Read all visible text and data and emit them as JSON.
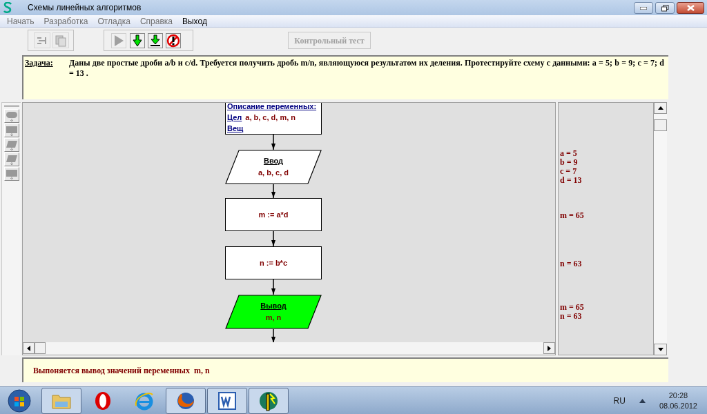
{
  "window": {
    "title": "Схемы линейных алгоритмов"
  },
  "menu": [
    {
      "label": "Начать",
      "disabled": true
    },
    {
      "label": "Разработка",
      "disabled": true
    },
    {
      "label": "Отладка",
      "disabled": true
    },
    {
      "label": "Справка",
      "disabled": true
    },
    {
      "label": "Выход",
      "disabled": false
    }
  ],
  "toolbar": {
    "edit_tools": [
      {
        "kind": "align",
        "disabled": true
      },
      {
        "kind": "copy",
        "disabled": true
      }
    ],
    "run_tools": [
      {
        "kind": "run",
        "disabled": true
      },
      {
        "kind": "step",
        "disabled": false
      },
      {
        "kind": "step_into",
        "disabled": false
      },
      {
        "kind": "stop",
        "disabled": false
      }
    ],
    "test_button": {
      "label": "Контрольный тест",
      "disabled": true
    }
  },
  "task": {
    "label": "Задача:",
    "text": "Даны две простые дроби a/b и c/d. Требуется получить дробь m/n, являющуюся результатом их деления. Протестируйте схему с данными: a = 5;  b = 9;  c = 7;  d = 13 ."
  },
  "palette": [
    {
      "kind": "terminator"
    },
    {
      "kind": "process"
    },
    {
      "kind": "input"
    },
    {
      "kind": "output"
    },
    {
      "kind": "process"
    }
  ],
  "flowchart": {
    "declaration": {
      "title": "Описание переменных:",
      "lines": [
        {
          "type": "Цел",
          "vars": "a, b, c, d, m, n"
        },
        {
          "type": "Вещ"
        }
      ]
    },
    "blocks": [
      {
        "kind": "input",
        "title": "Ввод",
        "text": "a, b, c, d",
        "active": false,
        "trace": [
          "a = 5",
          "b = 9",
          "c = 7",
          "d = 13"
        ]
      },
      {
        "kind": "process",
        "text": "m := a*d",
        "active": false,
        "trace": [
          "m = 65"
        ]
      },
      {
        "kind": "process",
        "text": "n := b*c",
        "active": false,
        "trace": [
          "n = 63"
        ]
      },
      {
        "kind": "output",
        "title": "Вывод",
        "text": "m, n",
        "active": true,
        "trace": [
          "m = 65",
          "n = 63"
        ]
      }
    ]
  },
  "status": "Выпоняется вывод значений переменных  m, n",
  "taskbar": {
    "apps": [
      {
        "kind": "folder",
        "running": true
      },
      {
        "kind": "opera",
        "running": false
      },
      {
        "kind": "ie",
        "running": false
      },
      {
        "kind": "firefox",
        "running": true
      },
      {
        "kind": "word",
        "running": true
      },
      {
        "kind": "app",
        "running": true
      }
    ],
    "language": "RU",
    "time": "20:28",
    "date": "08.06.2012"
  }
}
